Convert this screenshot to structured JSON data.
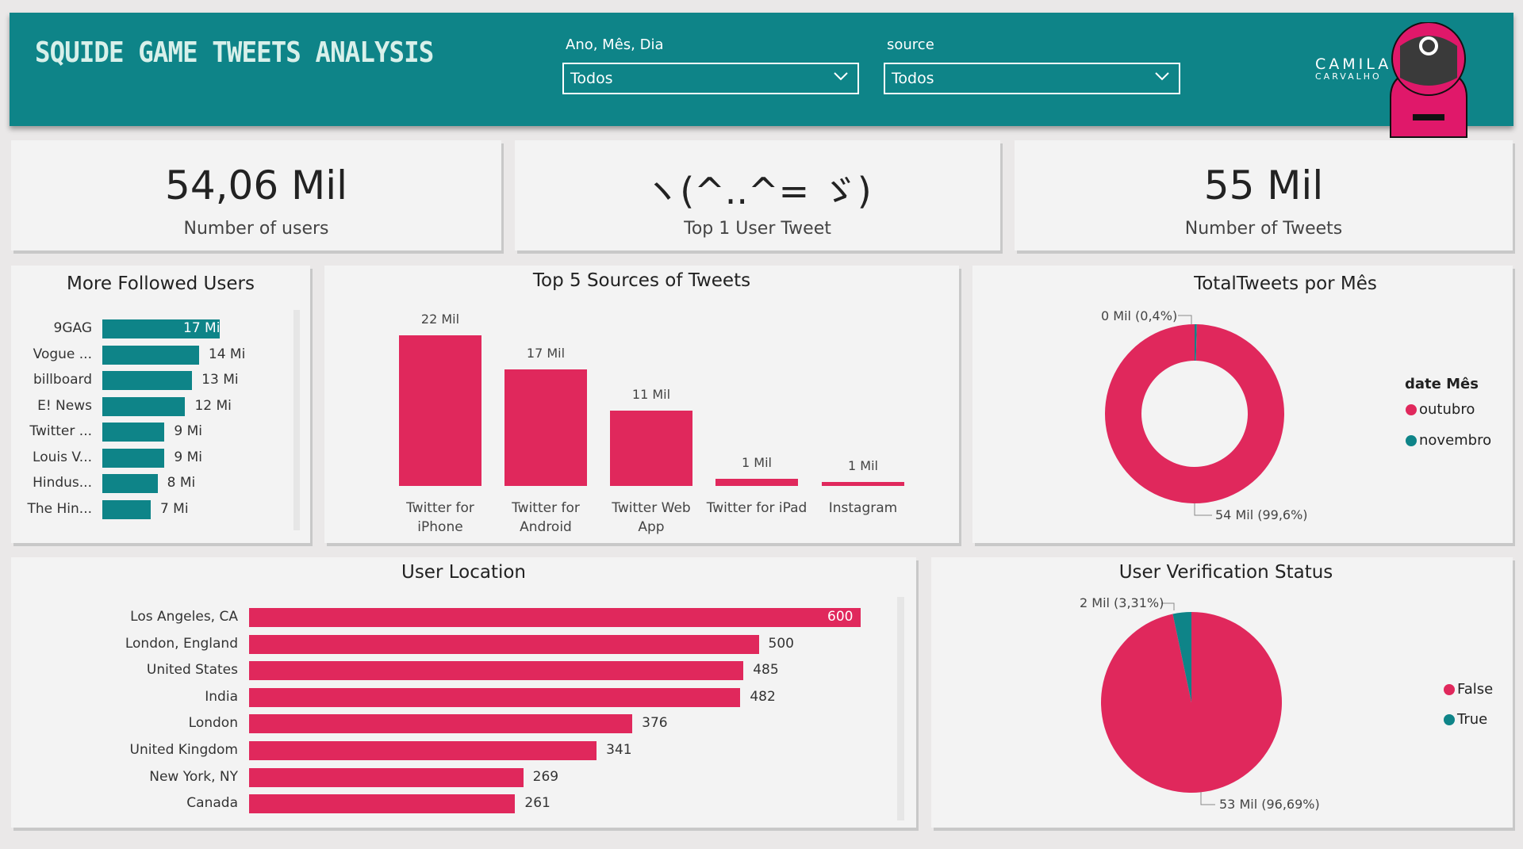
{
  "header": {
    "title": "SQUIDE GAME TWEETS ANALYSIS",
    "slicer_date": {
      "label": "Ano, Mês, Dia",
      "value": "Todos"
    },
    "slicer_source": {
      "label": "source",
      "value": "Todos"
    },
    "logo_line1": "CAMILA",
    "logo_line2": "CARVALHO"
  },
  "kpis": {
    "users": {
      "value": "54,06 Mil",
      "label": "Number of users"
    },
    "top_user": {
      "value": "ヽ(^..^= ゞ)",
      "label": "Top 1 User Tweet"
    },
    "tweets": {
      "value": "55 Mil",
      "label": "Number of Tweets"
    }
  },
  "colors": {
    "teal": "#0e8488",
    "pink": "#e0285c"
  },
  "chart_data": [
    {
      "type": "bar",
      "orientation": "horizontal",
      "title": "More Followed Users",
      "categories": [
        "9GAG",
        "Vogue ...",
        "billboard",
        "E! News",
        "Twitter ...",
        "Louis V...",
        "Hindus...",
        "The Hin..."
      ],
      "values": [
        17,
        14,
        13,
        12,
        9,
        9,
        8,
        7
      ],
      "labels": [
        "17 Mi",
        "14 Mi",
        "13 Mi",
        "12 Mi",
        "9 Mi",
        "9 Mi",
        "8 Mi",
        "7 Mi"
      ],
      "color": "#0e8488"
    },
    {
      "type": "bar",
      "title": "Top 5 Sources of Tweets",
      "categories": [
        [
          "Twitter for",
          "iPhone"
        ],
        [
          "Twitter for",
          "Android"
        ],
        [
          "Twitter Web",
          "App"
        ],
        [
          "Twitter for iPad"
        ],
        [
          "Instagram"
        ]
      ],
      "values": [
        22,
        17,
        11,
        1,
        0.6
      ],
      "labels": [
        "22 Mil",
        "17 Mil",
        "11 Mil",
        "1 Mil",
        "1 Mil"
      ],
      "color": "#e0285c"
    },
    {
      "type": "pie",
      "variant": "donut",
      "title": "TotalTweets por Mês",
      "legend_title": "date Mês",
      "slices": [
        {
          "name": "outubro",
          "value": 54,
          "percent": 99.6,
          "label": "54 Mil (99,6%)",
          "color": "#e0285c"
        },
        {
          "name": "novembro",
          "value": 0.2,
          "percent": 0.4,
          "label": "0 Mil (0,4%)",
          "color": "#0e8488"
        }
      ],
      "legend_placement": "right"
    },
    {
      "type": "bar",
      "orientation": "horizontal",
      "title": "User Location",
      "categories": [
        "Los Angeles, CA",
        "London, England",
        "United States",
        "India",
        "London",
        "United Kingdom",
        "New York, NY",
        "Canada"
      ],
      "values": [
        600,
        500,
        485,
        482,
        376,
        341,
        269,
        261
      ],
      "labels": [
        "600",
        "500",
        "485",
        "482",
        "376",
        "341",
        "269",
        "261"
      ],
      "color": "#e0285c"
    },
    {
      "type": "pie",
      "title": "User Verification Status",
      "slices": [
        {
          "name": "False",
          "value": 53,
          "percent": 96.69,
          "label": "53 Mil (96,69%)",
          "color": "#e0285c"
        },
        {
          "name": "True",
          "value": 2,
          "percent": 3.31,
          "label": "2 Mil (3,31%)",
          "color": "#0e8488"
        }
      ],
      "legend_placement": "right"
    }
  ]
}
